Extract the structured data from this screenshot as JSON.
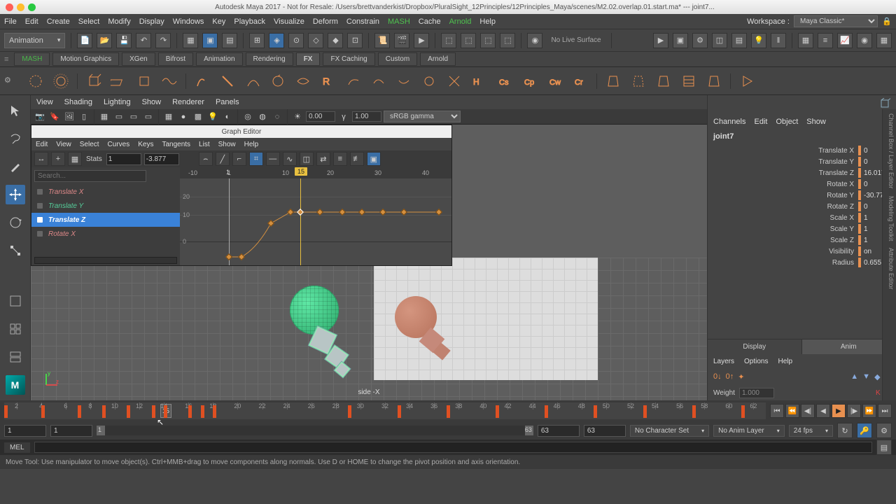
{
  "titlebar": {
    "title": "Autodesk Maya 2017 - Not for Resale: /Users/brettvanderkist/Dropbox/PluralSight_12Principles/12Principles_Maya/scenes/M2.02.overlap.01.start.ma*  ---  joint7..."
  },
  "menubar": {
    "items": [
      "File",
      "Edit",
      "Create",
      "Select",
      "Modify",
      "Display",
      "Windows",
      "Key",
      "Playback",
      "Visualize",
      "Deform",
      "Constrain"
    ],
    "mash": "MASH",
    "cache": "Cache",
    "arnold": "Arnold",
    "help": "Help",
    "workspace_label": "Workspace :",
    "workspace_value": "Maya Classic*"
  },
  "shelf": {
    "mode": "Animation",
    "no_live": "No Live Surface"
  },
  "shelftabs": [
    "MASH",
    "Motion Graphics",
    "XGen",
    "Bifrost",
    "Animation",
    "Rendering",
    "FX",
    "FX Caching",
    "Custom",
    "Arnold"
  ],
  "viewport": {
    "menu": [
      "View",
      "Shading",
      "Lighting",
      "Show",
      "Renderer",
      "Panels"
    ],
    "exp": "0.00",
    "gamma": "1.00",
    "colorspace": "sRGB gamma",
    "label": "side -X"
  },
  "grapheditor": {
    "title": "Graph Editor",
    "menu": [
      "Edit",
      "View",
      "Select",
      "Curves",
      "Keys",
      "Tangents",
      "List",
      "Show",
      "Help"
    ],
    "stats_label": "Stats",
    "stats_frame": "1",
    "stats_value": "-3.877",
    "search": "Search...",
    "channels": [
      {
        "name": "Translate X",
        "cls": "c-tx"
      },
      {
        "name": "Translate Y",
        "cls": "c-ty"
      },
      {
        "name": "Translate Z",
        "cls": "c-tz",
        "sel": true
      },
      {
        "name": "Rotate X",
        "cls": "c-rx"
      }
    ],
    "ruler": {
      "neg10": "-10",
      "f1": "1",
      "f10": "10",
      "f15": "15",
      "f20": "20",
      "f30": "30",
      "f40": "40"
    },
    "ylabels": {
      "y20": "20",
      "y10": "10",
      "y0": "0"
    }
  },
  "channelbox": {
    "menu": [
      "Channels",
      "Edit",
      "Object",
      "Show"
    ],
    "object": "joint7",
    "attrs": [
      {
        "label": "Translate X",
        "value": "0"
      },
      {
        "label": "Translate Y",
        "value": "0"
      },
      {
        "label": "Translate Z",
        "value": "16.017"
      },
      {
        "label": "Rotate X",
        "value": "0"
      },
      {
        "label": "Rotate Y",
        "value": "-30.775"
      },
      {
        "label": "Rotate Z",
        "value": "0"
      },
      {
        "label": "Scale X",
        "value": "1"
      },
      {
        "label": "Scale Y",
        "value": "1"
      },
      {
        "label": "Scale Z",
        "value": "1"
      },
      {
        "label": "Visibility",
        "value": "on"
      },
      {
        "label": "Radius",
        "value": "0.655"
      }
    ],
    "tabs": {
      "display": "Display",
      "anim": "Anim"
    },
    "layers_menu": [
      "Layers",
      "Options",
      "Help"
    ],
    "weight_label": "Weight",
    "weight_value": "1.000",
    "side_tabs": [
      "Channel Box / Layer Editor",
      "Modeling Toolkit",
      "Attribute Editor"
    ]
  },
  "timeslider": {
    "current": "15",
    "keys_at": [
      1,
      4,
      7,
      9,
      11,
      13,
      14,
      16,
      17,
      18,
      29,
      33,
      37,
      41,
      45,
      49,
      53,
      57,
      61
    ]
  },
  "rangebar": {
    "start_outer": "1",
    "start_inner": "1",
    "pos": "1",
    "end_inner": "63",
    "end_outer": "63",
    "end_out2": "63",
    "charset": "No Character Set",
    "animlayer": "No Anim Layer",
    "fps": "24 fps"
  },
  "cmdline": {
    "lang": "MEL"
  },
  "status": {
    "text": "Move Tool: Use manipulator to move object(s). Ctrl+MMB+drag to move components along normals. Use D or HOME to change the pivot position and axis orientation."
  }
}
